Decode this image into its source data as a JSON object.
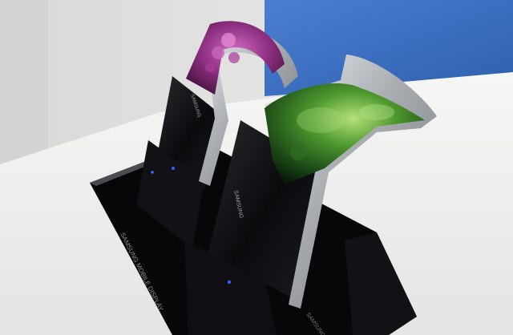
{
  "photo": {
    "stand_label": "SAMSUNG MOBILE DISPLAY",
    "device_left_label": "SAMSUNG",
    "device_right_label": "SAMSUNG",
    "base_front_label": "SAMSUNG"
  },
  "colors": {
    "wall_blue": "#3f73c4",
    "wall_white": "#e6e6e4",
    "table_white": "#f1f1f0",
    "stand_black": "#0a0a0d",
    "frame_silver": "#b9bcc0",
    "screen_purple": "#8a2c7a",
    "screen_green": "#3f8a2a"
  }
}
